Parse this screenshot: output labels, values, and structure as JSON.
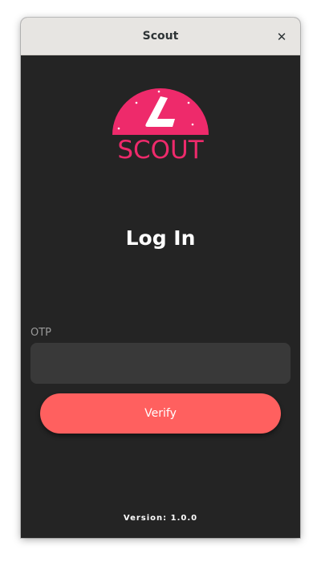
{
  "window": {
    "title": "Scout",
    "close_label": "✕"
  },
  "logo": {
    "wordmark": "SCOUT",
    "color": "#ee2a6b"
  },
  "login": {
    "heading": "Log In",
    "otp_label": "OTP",
    "otp_value": "",
    "otp_placeholder": "",
    "verify_label": "Verify"
  },
  "footer": {
    "version": "Version: 1.0.0"
  },
  "colors": {
    "background": "#242424",
    "input_background": "#393939",
    "button": "#ff605f",
    "titlebar": "#e7e5e2"
  }
}
